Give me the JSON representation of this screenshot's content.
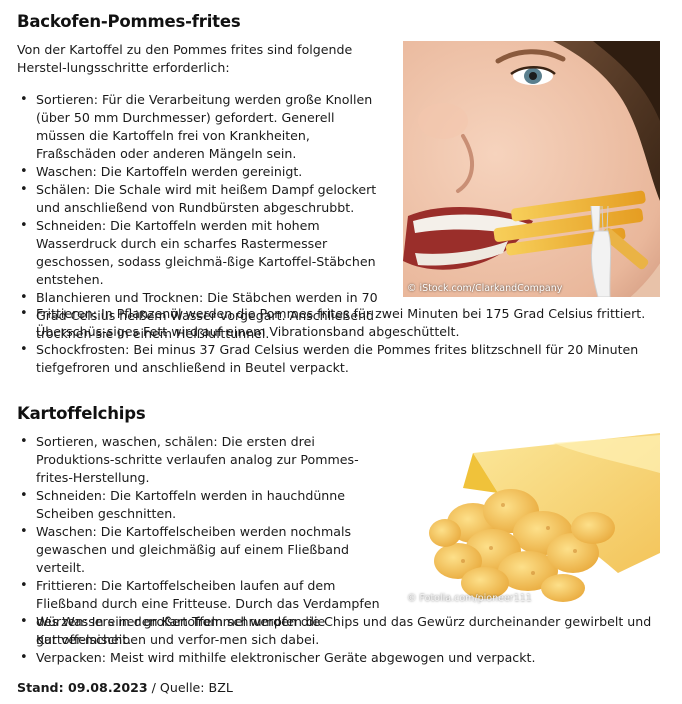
{
  "section1": {
    "title": "Backofen-Pommes-frites",
    "intro": "Von der Kartoffel zu den Pommes frites sind folgende Herstel-lungsschritte erforderlich:",
    "steps": [
      "Sortieren: Für die Verarbeitung werden große Knollen (über 50 mm Durchmesser) gefordert. Generell müssen die Kartoffeln frei von Krankheiten, Fraßschäden oder anderen Mängeln sein.",
      "Waschen: Die Kartoffeln werden gereinigt.",
      "Schälen: Die Schale wird mit heißem Dampf gelockert und anschließend von Rundbürsten abgeschrubbt.",
      "Schneiden: Die Kartoffeln werden mit hohem Wasserdruck durch ein scharfes Rastermesser geschossen, sodass gleichmä-ßige Kartoffel-Stäbchen entstehen.",
      "Blanchieren und Trocknen: Die Stäbchen werden in 70 Grad Celsius heißem Wasser vorgegart. Anschließend trocknen sie in einem Heißlufttunnel.",
      "Frittieren: In Pflanzenöl werden die Pommes frites für zwei Minuten bei 175 Grad Celsius frittiert. Überschüs-siges Fett wird auf einem Vibrationsband abgeschüttelt.",
      "Schockfrosten: Bei minus 37 Grad Celsius werden die Pommes frites blitzschnell für 20 Minuten tiefgefroren und anschließend in Beutel verpackt."
    ],
    "image_credit": "© iStock.com/ClarkandCompany"
  },
  "section2": {
    "title": "Kartoffelchips",
    "steps": [
      "Sortieren, waschen, schälen: Die ersten drei Produktions-schritte verlaufen analog zur Pommes-frites-Herstellung.",
      "Schneiden: Die Kartoffeln werden in hauchdünne Scheiben geschnitten.",
      "Waschen: Die Kartoffelscheiben werden nochmals gewaschen und gleichmäßig auf einem Fließband verteilt.",
      "Frittieren: Die Kartoffelscheiben laufen auf dem Fließband durch eine Fritteuse. Durch das Verdampfen des Wassers in den Kartoffeln schrumpfen die Kartoffelscheiben und verfor-men sich dabei.",
      "Würzen: In einer großen Trommel werden die Chips und das Gewürz durcheinander gewirbelt und gut ver-mischt.",
      "Verpacken: Meist wird mithilfe elektronischer Geräte abgewogen und verpackt."
    ],
    "image_credit": "© Fotolia.com/pioneer111"
  },
  "footer": {
    "stand": "Stand: 09.08.2023",
    "separator": " / ",
    "source": "Quelle: BZL"
  }
}
